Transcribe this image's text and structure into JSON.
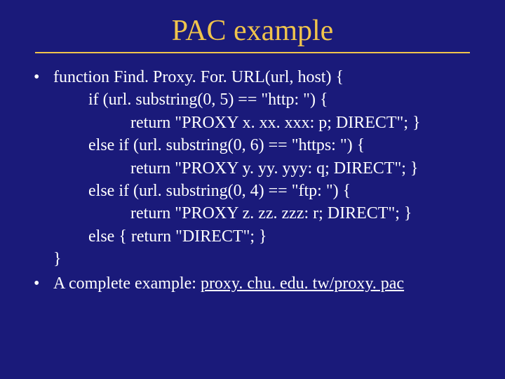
{
  "title": "PAC example",
  "bullets": [
    {
      "lead": "function Find. Proxy. For. URL(url, host) {",
      "lines": [
        {
          "indent": 1,
          "text": "if (url. substring(0, 5) == \"http: \") {"
        },
        {
          "indent": 2,
          "text": "return \"PROXY x. xx. xxx: p; DIRECT\"; }"
        },
        {
          "indent": 1,
          "text": "else if (url. substring(0, 6) == \"https: \") {"
        },
        {
          "indent": 2,
          "text": "return \"PROXY y. yy. yyy: q; DIRECT\"; }"
        },
        {
          "indent": 1,
          "text": "else if (url. substring(0, 4) == \"ftp: \") {"
        },
        {
          "indent": 2,
          "text": "return \"PROXY z. zz. zzz: r; DIRECT\"; }"
        },
        {
          "indent": 1,
          "text": "else { return \"DIRECT\"; }"
        },
        {
          "indent": 0,
          "text": "}"
        }
      ]
    },
    {
      "lead_prefix": "A complete example: ",
      "link_text": "proxy. chu. edu. tw/proxy. pac"
    }
  ]
}
